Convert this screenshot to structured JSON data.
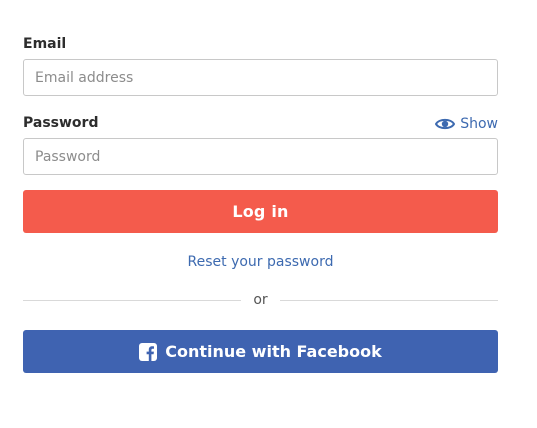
{
  "email": {
    "label": "Email",
    "placeholder": "Email address",
    "value": ""
  },
  "password": {
    "label": "Password",
    "placeholder": "Password",
    "value": "",
    "show_label": "Show",
    "show_icon": "eye-icon"
  },
  "login_button": {
    "label": "Log in",
    "color": "#f45b4c"
  },
  "reset_link": {
    "label": "Reset your password",
    "color": "#3d6ab0"
  },
  "divider": {
    "label": "or"
  },
  "facebook_button": {
    "label": "Continue with Facebook",
    "icon": "facebook-icon",
    "color": "#3f63b1"
  }
}
